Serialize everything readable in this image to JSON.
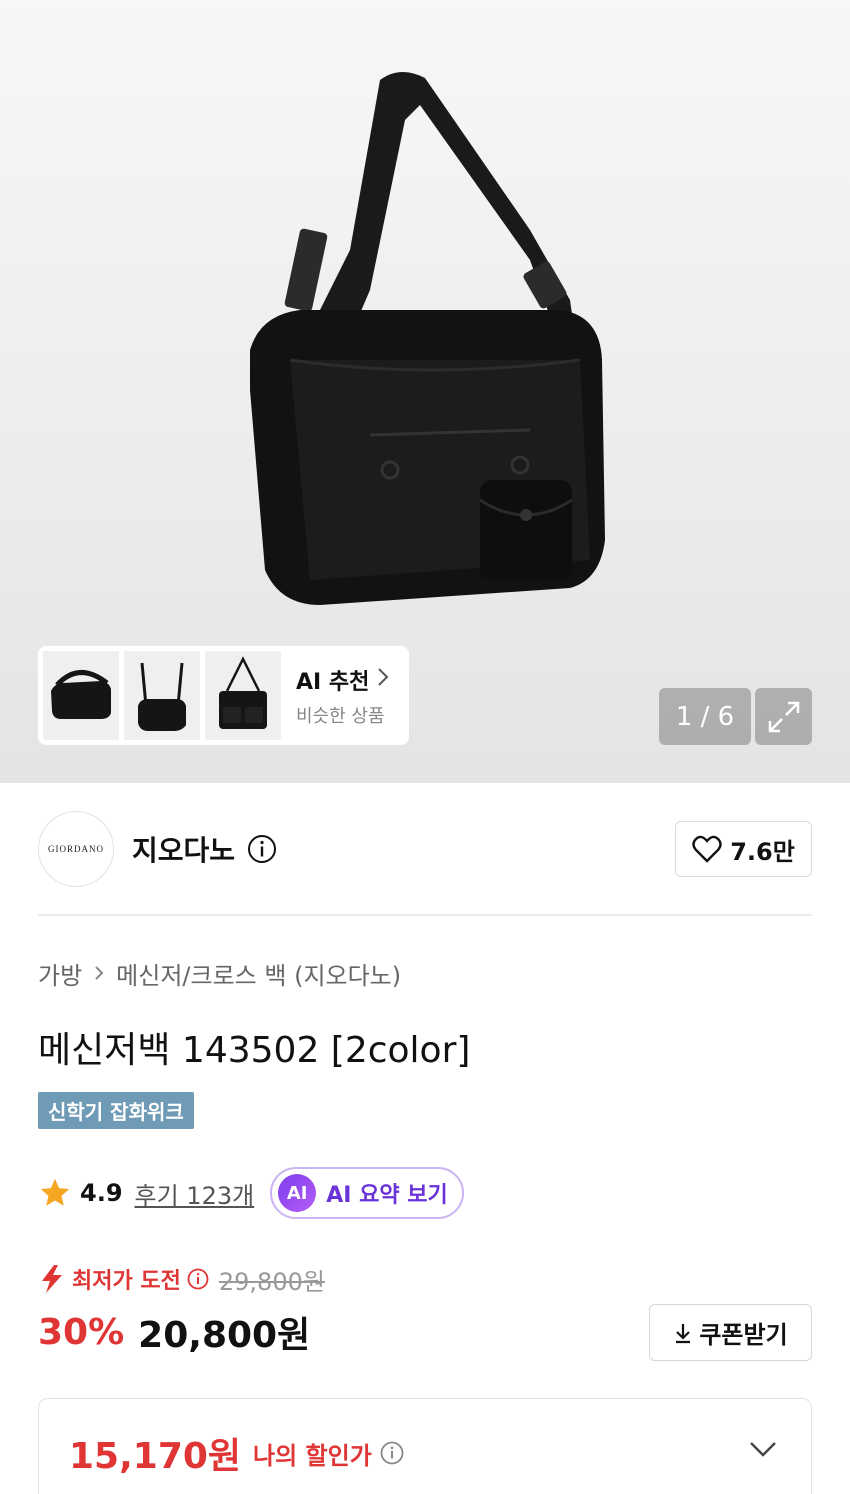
{
  "gallery": {
    "counter": "1 / 6",
    "ai_recommend": {
      "title": "AI 추천",
      "subtitle": "비슷한 상품"
    }
  },
  "brand": {
    "logo_text": "GIORDANO",
    "name": "지오다노",
    "likes": "7.6만"
  },
  "product": {
    "breadcrumb": [
      "가방",
      "메신저/크로스 백 (지오다노)"
    ],
    "title": "메신저백 143502 [2color]",
    "tag": "신학기 잡화위크",
    "rating": "4.9",
    "reviews": "후기 123개",
    "ai_summary": {
      "badge": "AI",
      "label": "AI 요약 보기"
    }
  },
  "pricing": {
    "lowest_label": "최저가 도전",
    "original_price": "29,800원",
    "discount": "30%",
    "price": "20,800원",
    "coupon_label": "쿠폰받기",
    "my_price": "15,170원",
    "my_price_label": "나의 할인가"
  },
  "colors": {
    "accent_red": "#e03535",
    "tag_blue": "#6f9bb7",
    "ai_purple": "#6a32d9",
    "star": "#f5a623"
  }
}
